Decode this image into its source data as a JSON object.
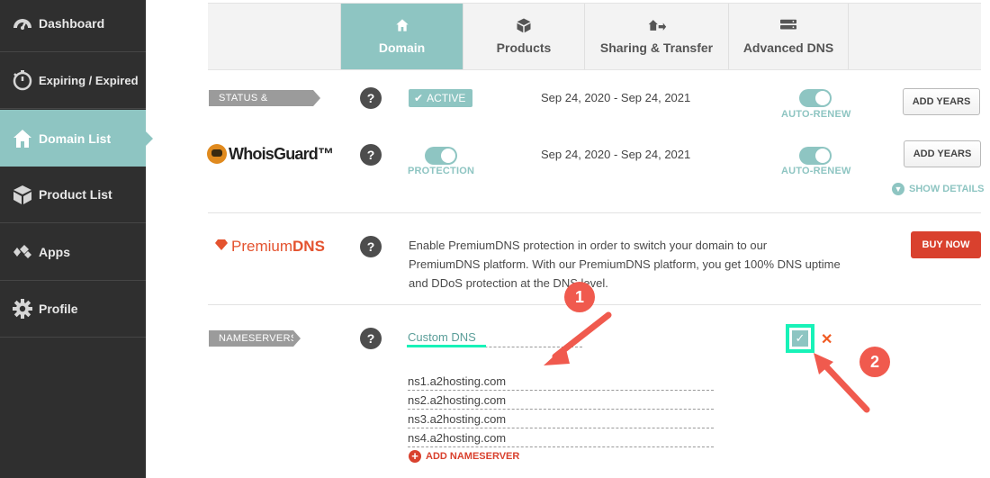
{
  "sidebar": {
    "items": [
      {
        "label": "Dashboard",
        "icon": "gauge-icon"
      },
      {
        "label": "Expiring / Expired",
        "icon": "stopwatch-icon"
      },
      {
        "label": "Domain List",
        "icon": "home-icon"
      },
      {
        "label": "Product List",
        "icon": "box-icon"
      },
      {
        "label": "Apps",
        "icon": "apps-icon"
      },
      {
        "label": "Profile",
        "icon": "gear-icon"
      }
    ],
    "active": "Domain List"
  },
  "tabs": [
    {
      "label": "Domain",
      "icon": "home-icon"
    },
    {
      "label": "Products",
      "icon": "box-icon"
    },
    {
      "label": "Sharing & Transfer",
      "icon": "transfer-icon"
    },
    {
      "label": "Advanced DNS",
      "icon": "server-icon"
    }
  ],
  "status_row": {
    "tag": "STATUS & VALIDITY",
    "help": "?",
    "badge": "ACTIVE",
    "dates": "Sep 24, 2020 - Sep 24, 2021",
    "toggle_label": "AUTO-RENEW",
    "button": "ADD YEARS"
  },
  "whoisguard_row": {
    "logo": "WhoisGuard™",
    "help": "?",
    "toggle_label": "PROTECTION",
    "dates": "Sep 24, 2020 - Sep 24, 2021",
    "auto_label": "AUTO-RENEW",
    "button": "ADD YEARS",
    "show_details": "SHOW DETAILS"
  },
  "premium_row": {
    "logo_prefix": "Premium",
    "logo_suffix": "DNS",
    "help": "?",
    "description": "Enable PremiumDNS protection in order to switch your domain to our PremiumDNS platform. With our PremiumDNS platform, you get 100% DNS uptime and DDoS protection at the DNS level.",
    "button": "BUY NOW"
  },
  "nameservers_row": {
    "tag": "NAMESERVERS",
    "help": "?",
    "dns_type": "Custom DNS",
    "servers": [
      "ns1.a2hosting.com",
      "ns2.a2hosting.com",
      "ns3.a2hosting.com",
      "ns4.a2hosting.com"
    ],
    "add_label": "ADD NAMESERVER",
    "add_icon": "+",
    "confirm_icon": "✓",
    "cancel_icon": "✕"
  },
  "annotations": [
    "1",
    "2"
  ],
  "colors": {
    "teal": "#8ec5c2",
    "red": "#d9412e",
    "annotation": "#f05a4e",
    "highlight": "#18f2b8",
    "sidebar": "#2f2f2f"
  }
}
